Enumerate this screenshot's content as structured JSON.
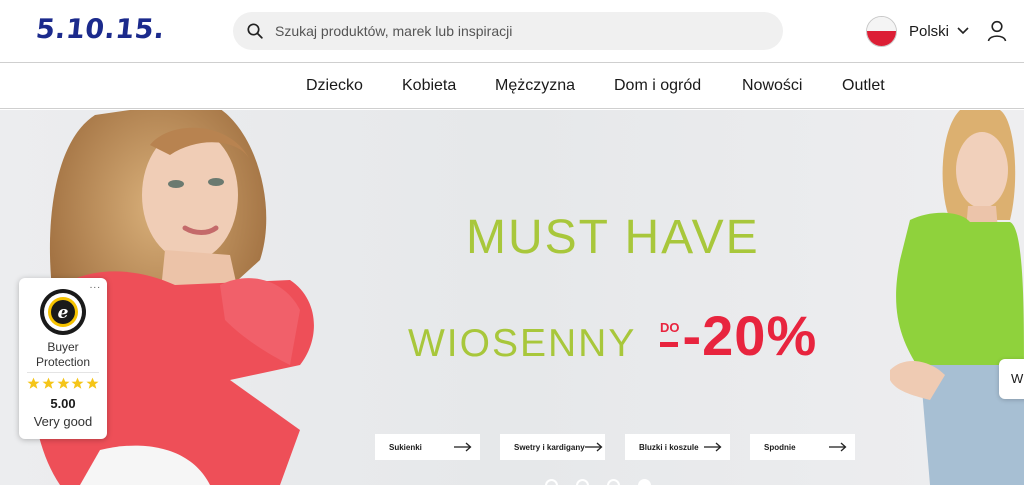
{
  "header": {
    "logo_text": "5.10.15.",
    "search": {
      "placeholder": "Szukaj produktów, marek lub inspiracji",
      "value": ""
    },
    "language": {
      "label": "Polski",
      "flag": "poland-flag-icon"
    },
    "icons": {
      "search": "search-icon",
      "account": "user-icon",
      "dropdown": "chevron-down-icon"
    }
  },
  "nav": {
    "items": [
      {
        "label": "Dziecko"
      },
      {
        "label": "Kobieta"
      },
      {
        "label": "Mężczyzna"
      },
      {
        "label": "Dom i ogród"
      },
      {
        "label": "Nowości"
      },
      {
        "label": "Outlet"
      }
    ]
  },
  "hero": {
    "headline": "MUST HAVE",
    "subheadline": "WIOSENNY",
    "promo_prefix": "DO",
    "promo_value": "-20%",
    "categories": [
      {
        "label": "Sukienki"
      },
      {
        "label": "Swetry i kardigany"
      },
      {
        "label": "Bluzki i koszule"
      },
      {
        "label": "Spodnie"
      }
    ],
    "slides": {
      "count": 4,
      "active": 4
    },
    "colors": {
      "headline": "#a8c73b",
      "promo": "#e8243e",
      "background": "#e9ebed"
    }
  },
  "trust_badge": {
    "menu": "...",
    "line1": "Buyer",
    "line2": "Protection",
    "stars": 5,
    "rating": "5.00",
    "rating_text": "Very good",
    "seal_icon": "trusted-shops-seal-icon"
  },
  "side_tab": {
    "label": "W"
  }
}
